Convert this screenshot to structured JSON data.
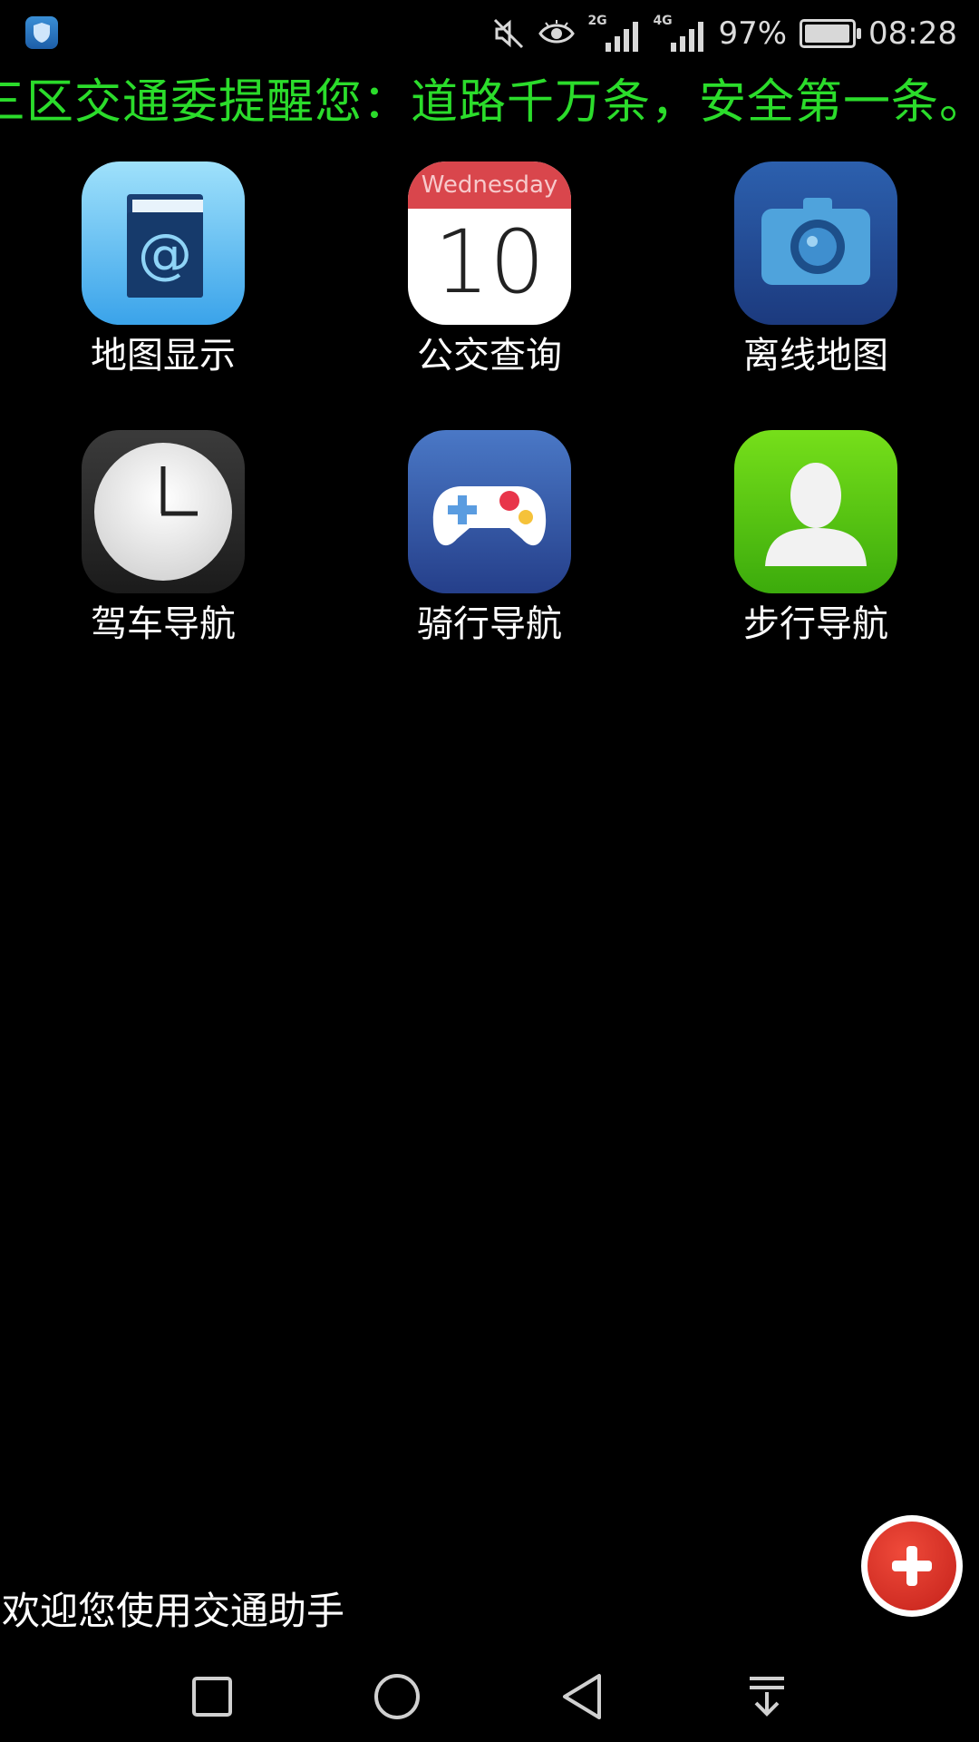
{
  "status_bar": {
    "net_1": "2G",
    "net_2": "4G",
    "battery": "97%",
    "battery_level": 0.97,
    "time": "08:28",
    "icons": [
      "security-shield-icon",
      "mute-icon",
      "eye-comfort-icon",
      "signal-icon",
      "signal-icon",
      "battery-icon"
    ]
  },
  "marquee": {
    "text": "三区交通委提醒您：道路千万条，安全第一条。",
    "color": "#2bdc2b"
  },
  "apps": [
    {
      "label": "地图显示",
      "icon": "contacts-book-icon"
    },
    {
      "label": "公交查询",
      "icon": "calendar-icon",
      "calendar_day": "Wednesday",
      "calendar_date": "10"
    },
    {
      "label": "离线地图",
      "icon": "camera-icon"
    },
    {
      "label": "驾车导航",
      "icon": "clock-icon"
    },
    {
      "label": "骑行导航",
      "icon": "gamepad-icon"
    },
    {
      "label": "步行导航",
      "icon": "person-icon"
    }
  ],
  "welcome_text": "欢迎您使用交通助手",
  "fab": {
    "icon": "plus-icon",
    "color": "#d32a1f"
  },
  "nav_bar": {
    "icons": [
      "recents-square-icon",
      "home-circle-icon",
      "back-triangle-icon",
      "notification-pulldown-icon"
    ]
  }
}
